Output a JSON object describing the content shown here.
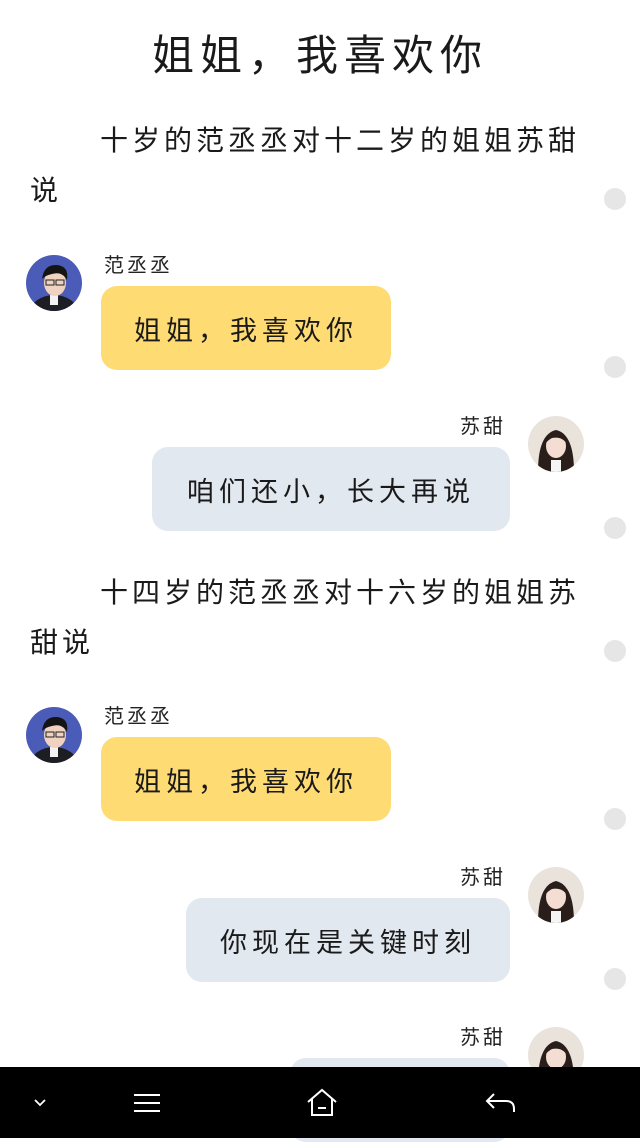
{
  "title": "姐姐，我喜欢你",
  "narrations": [
    "十岁的范丞丞对十二岁的姐姐苏甜说",
    "十四岁的范丞丞对十六岁的姐姐苏甜说"
  ],
  "messages": [
    {
      "sender": "范丞丞",
      "text": "姐姐，我喜欢你",
      "side": "left"
    },
    {
      "sender": "苏甜",
      "text": "咱们还小，长大再说",
      "side": "right"
    },
    {
      "sender": "范丞丞",
      "text": "姐姐，我喜欢你",
      "side": "left"
    },
    {
      "sender": "苏甜",
      "text": "你现在是关键时刻",
      "side": "right"
    },
    {
      "sender": "苏甜",
      "text": "",
      "side": "right"
    }
  ],
  "colors": {
    "left_bubble": "#fedb73",
    "right_bubble": "#e2e8ef",
    "navbar": "#000000"
  },
  "navbar": {
    "icons": [
      "chevron-down-icon",
      "menu-icon",
      "home-icon",
      "back-icon"
    ]
  }
}
